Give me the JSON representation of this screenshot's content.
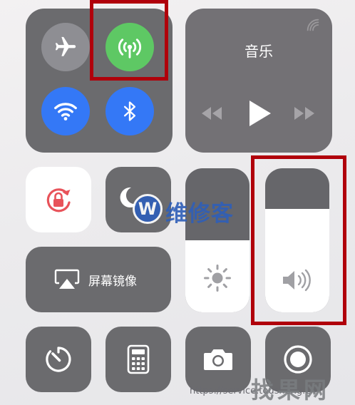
{
  "connectivity": {
    "airplane": {
      "icon": "airplane-icon",
      "state": "off",
      "color": "#8e8e93"
    },
    "cellular": {
      "icon": "cellular-antenna-icon",
      "state": "on",
      "color": "#5ec864"
    },
    "wifi": {
      "icon": "wifi-icon",
      "state": "on",
      "color": "#3478f6"
    },
    "bluetooth": {
      "icon": "bluetooth-icon",
      "state": "on",
      "color": "#3478f6"
    }
  },
  "music": {
    "title": "音乐",
    "airplay_icon": "airplay-audio-icon",
    "prev_icon": "rewind-icon",
    "play_icon": "play-icon",
    "next_icon": "fast-forward-icon"
  },
  "rotation_lock": {
    "icon": "rotation-lock-icon",
    "state": "on",
    "accent": "#e8535a"
  },
  "do_not_disturb": {
    "icon": "moon-icon",
    "state": "off"
  },
  "screen_mirroring": {
    "label": "屏幕镜像",
    "icon": "screen-mirroring-icon"
  },
  "brightness": {
    "level": 0.5,
    "icon": "sun-icon"
  },
  "volume": {
    "level": 0.72,
    "icon": "speaker-icon"
  },
  "shortcuts": [
    {
      "icon": "timer-icon"
    },
    {
      "icon": "calculator-icon"
    },
    {
      "icon": "camera-icon"
    },
    {
      "icon": "screen-record-icon"
    }
  ],
  "watermark": {
    "logo_letter": "W",
    "brand": "维修客",
    "footer_url": "https://service.tousheng.cn",
    "footer_brand": "找果网"
  }
}
